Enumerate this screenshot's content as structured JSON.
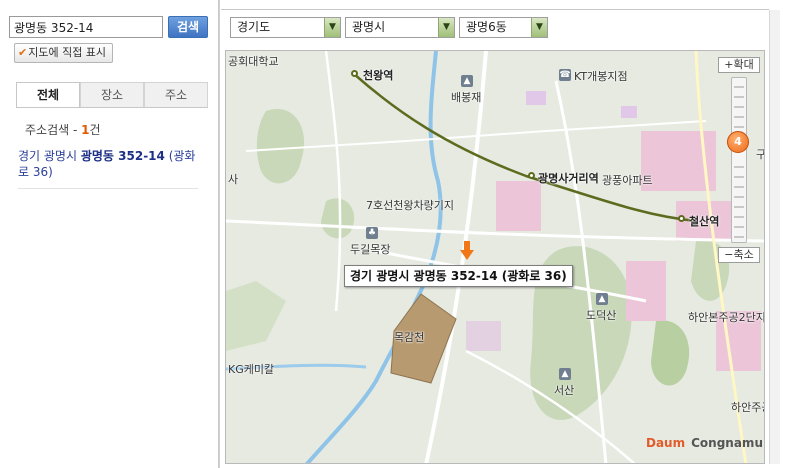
{
  "search": {
    "query": "광명동 352-14",
    "button_label": "검색",
    "mark_label": "지도에 직접 표시"
  },
  "tabs": [
    {
      "label": "전체",
      "active": true
    },
    {
      "label": "장소",
      "active": false
    },
    {
      "label": "주소",
      "active": false
    }
  ],
  "results": {
    "count_prefix": "주소검색 - ",
    "count_value": "1",
    "count_suffix": "건",
    "item_prefix": "경기 광명시 ",
    "item_bold": "광명동 352-14",
    "item_suffix": " (광화로 36)"
  },
  "region": {
    "province": "경기도",
    "city": "광명시",
    "dong": "광명6동"
  },
  "map": {
    "callout": "경기 광명시 광명동 352-14 (광화로 36)",
    "labels": {
      "univ": "공회대학교",
      "cheonwang": "천왕역",
      "baebongjae": "배봉재",
      "kt": "KT개봉지점",
      "gwangmyeongsageori": "광명사거리역",
      "pungapt": "광풍아파트",
      "cheolsan": "철산역",
      "depot": "7호선천왕차량기지",
      "dugil": "두길목장",
      "dodeoksan": "도덕산",
      "mokgamcheon": "목감천",
      "kgchem": "KG케미칼",
      "seosan": "서산",
      "hanan2": "하안본주공2단지",
      "hanan": "하안주공",
      "edge_sa": "사",
      "edge_gwang": "광",
      "edge_gu": "구"
    },
    "zoom_in": "확대",
    "zoom_out": "축소",
    "zoom_level": 4,
    "logo_daum": "Daum",
    "logo_cong": "Congnamul",
    "colors": {
      "subway_line": "#5d6b1e",
      "park": "#c8d8b8",
      "residential": "#ecc6d8",
      "target_lot": "#b89a70",
      "pin": "#f07818"
    }
  }
}
